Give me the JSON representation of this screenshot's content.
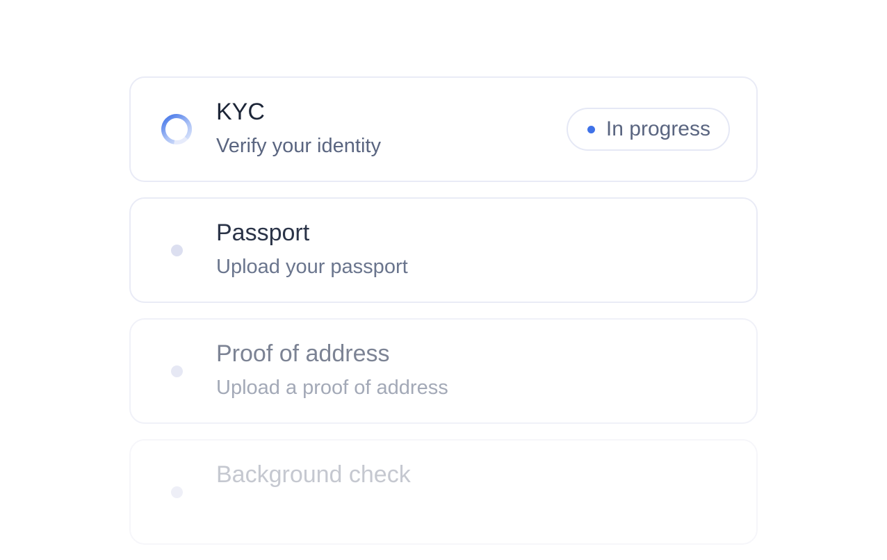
{
  "steps": [
    {
      "title": "KYC",
      "subtitle": "Verify your identity",
      "state": "in-progress",
      "badge": "In progress"
    },
    {
      "title": "Passport",
      "subtitle": "Upload your passport",
      "state": "pending"
    },
    {
      "title": "Proof of address",
      "subtitle": "Upload a proof of address",
      "state": "pending"
    },
    {
      "title": "Background check",
      "subtitle": "",
      "state": "pending"
    }
  ],
  "colors": {
    "accent": "#3f72e8",
    "border": "#e9ebf6",
    "title": "#1c2537",
    "subtitle": "#5a6580"
  },
  "icons": {
    "in_progress": "spinner-icon",
    "pending": "pending-dot-icon",
    "badge": "status-dot-icon"
  }
}
